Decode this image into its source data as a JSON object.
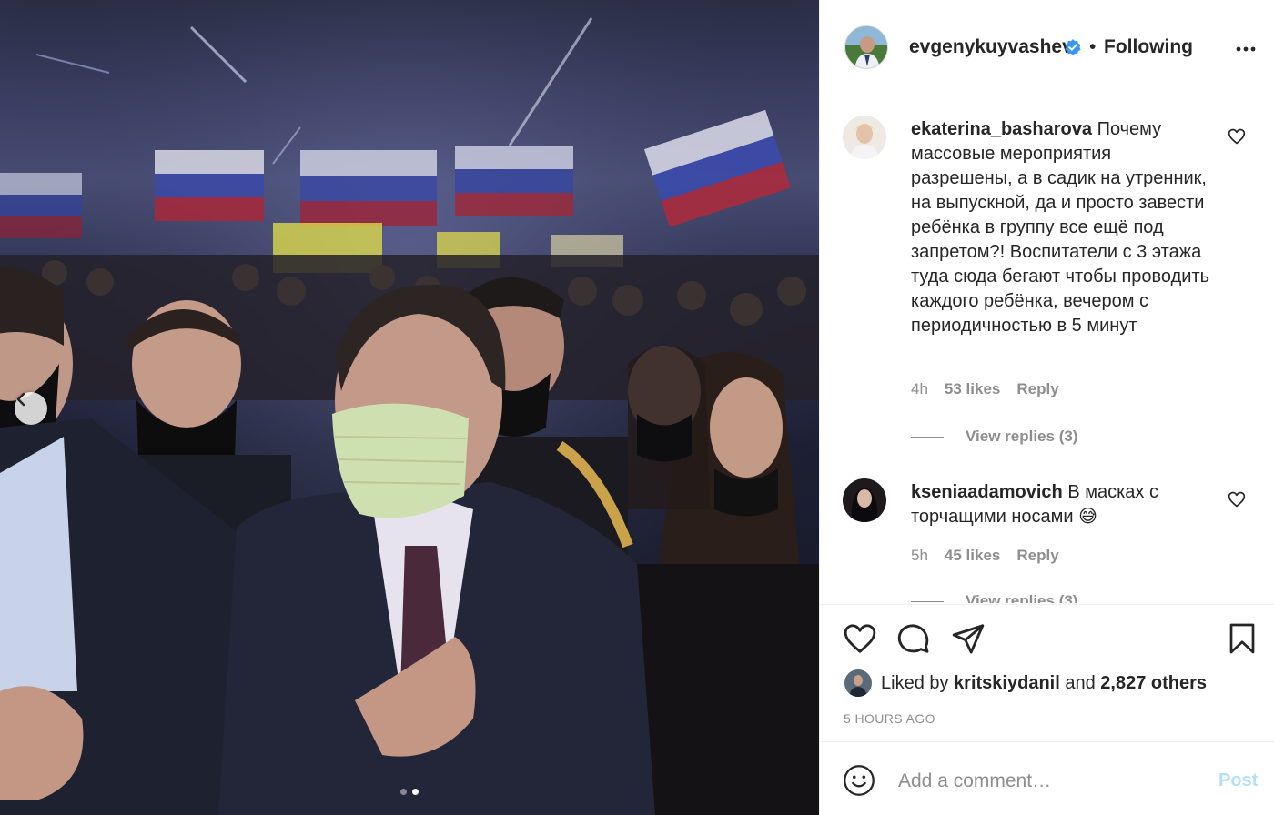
{
  "post": {
    "author": "evgenykuyvashev",
    "separator": "•",
    "follow_status": "Following",
    "icons": {
      "more": "more-horizontal-icon",
      "verified": "verified-badge-icon"
    },
    "carousel": {
      "slides": 2,
      "active": 2
    }
  },
  "comments": [
    {
      "username": "ekaterina_basharova",
      "text": "Почему массовые мероприятия разрешены, а в садик на утренник, на выпускной, да и просто завести ребёнка в группу все ещё под запретом?! Воспитатели с 3 этажа туда сюда бегают чтобы проводить каждого ребёнка, вечером с периодичностью в 5 минут",
      "time": "4h",
      "likes": "53 likes",
      "reply": "Reply",
      "view_replies": "View replies (3)"
    },
    {
      "username": "kseniaadamovich",
      "text": "В масках с торчащими носами 😅",
      "time": "5h",
      "likes": "45 likes",
      "reply": "Reply",
      "view_replies": "View replies (3)"
    }
  ],
  "likes": {
    "prefix": "Liked by",
    "user": "kritskiydanil",
    "middle": "and",
    "others": "2,827 others"
  },
  "timestamp": "5 HOURS AGO",
  "add_comment": {
    "placeholder": "Add a comment…",
    "post_label": "Post"
  },
  "colors": {
    "link_blue": "#0095f6",
    "post_disabled": "#b2dffc",
    "meta_gray": "#8e8e8e"
  }
}
